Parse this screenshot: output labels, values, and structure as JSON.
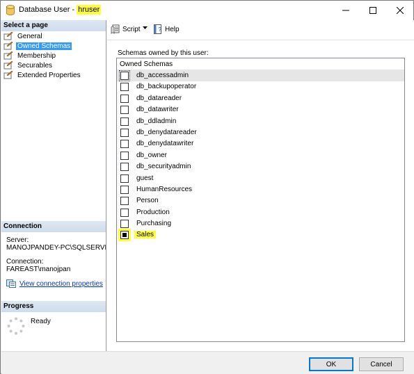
{
  "window": {
    "title_prefix": "Database User - ",
    "title_user": "hruser"
  },
  "left": {
    "select_header": "Select a page",
    "pages": [
      {
        "label": "General",
        "selected": false
      },
      {
        "label": "Owned Schemas",
        "selected": true
      },
      {
        "label": "Membership",
        "selected": false
      },
      {
        "label": "Securables",
        "selected": false
      },
      {
        "label": "Extended Properties",
        "selected": false
      }
    ],
    "connection_header": "Connection",
    "server_label": "Server:",
    "server_value": "MANOJPANDEY-PC\\SQLSERVE",
    "connection_label": "Connection:",
    "connection_value": "FAREAST\\manojpan",
    "view_props_link": "View connection properties",
    "progress_header": "Progress",
    "progress_status": "Ready"
  },
  "toolbar": {
    "script_label": "Script",
    "help_label": "Help"
  },
  "schemas": {
    "label": "Schemas owned by this user:",
    "column_header": "Owned Schemas",
    "rows": [
      {
        "name": "db_accessadmin",
        "checked": false
      },
      {
        "name": "db_backupoperator",
        "checked": false
      },
      {
        "name": "db_datareader",
        "checked": false
      },
      {
        "name": "db_datawriter",
        "checked": false
      },
      {
        "name": "db_ddladmin",
        "checked": false
      },
      {
        "name": "db_denydatareader",
        "checked": false
      },
      {
        "name": "db_denydatawriter",
        "checked": false
      },
      {
        "name": "db_owner",
        "checked": false
      },
      {
        "name": "db_securityadmin",
        "checked": false
      },
      {
        "name": "guest",
        "checked": false
      },
      {
        "name": "HumanResources",
        "checked": false
      },
      {
        "name": "Person",
        "checked": false
      },
      {
        "name": "Production",
        "checked": false
      },
      {
        "name": "Purchasing",
        "checked": false
      },
      {
        "name": "Sales",
        "checked": true
      }
    ]
  },
  "buttons": {
    "ok": "OK",
    "cancel": "Cancel"
  },
  "colors": {
    "highlight": "#ffff33",
    "selection": "#3399ff",
    "link": "#0033cc"
  }
}
